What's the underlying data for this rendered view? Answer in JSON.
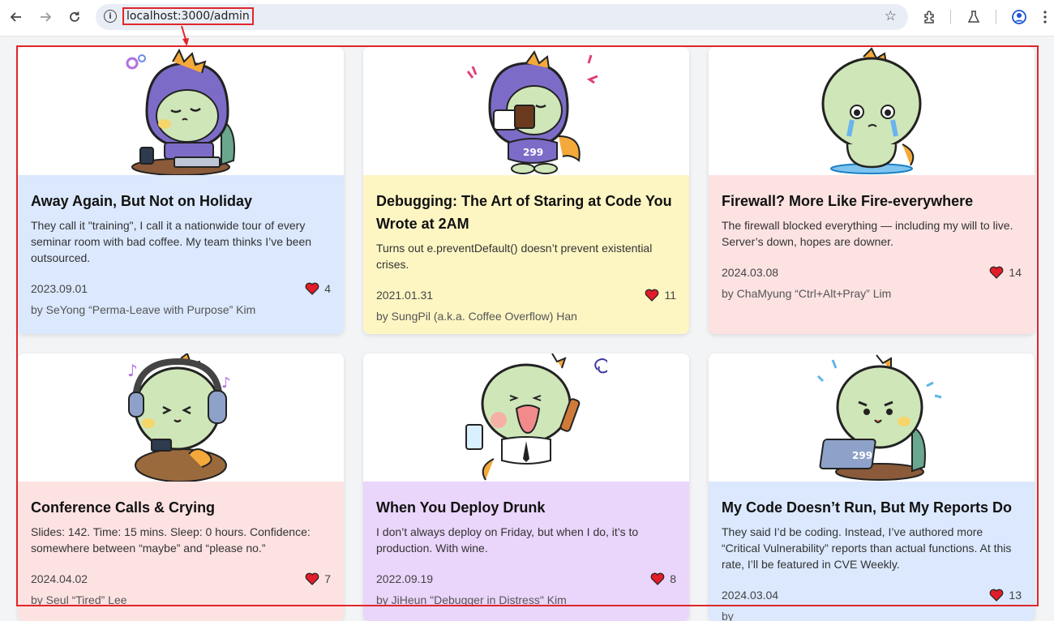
{
  "browser": {
    "url_host": "localhost",
    "url_path": ":3000/admin",
    "icons": [
      "back-arrow-icon",
      "forward-arrow-icon",
      "reload-icon",
      "site-info-icon",
      "bookmark-star-icon",
      "extensions-icon",
      "labs-flask-icon",
      "profile-icon",
      "menu-dots-icon"
    ]
  },
  "annotation": {
    "color": "#e0262b"
  },
  "cards": [
    {
      "title": "Away Again, But Not on Holiday",
      "text": "They call it \"training\", I call it a nationwide tour of every seminar room with bad coffee. My team thinks I’ve been outsourced.",
      "date": "2023.09.01",
      "likes": "4",
      "author": "by SeYong “Perma-Leave with Purpose” Kim",
      "color": "#dbe8fd",
      "art": "dino-hoodie-laptop"
    },
    {
      "title": "Debugging: The Art of Staring at Code You Wrote at 2AM",
      "text": "Turns out e.preventDefault() doesn’t prevent existential crises.",
      "date": "2021.01.31",
      "likes": "11",
      "author": "by SungPil (a.k.a. Coffee Overflow) Han",
      "color": "#fdf6c3",
      "art": "dino-hoodie-coffee"
    },
    {
      "title": "Firewall? More Like Fire-everywhere",
      "text": "The firewall blocked everything — including my will to live. Server’s down, hopes are downer.",
      "date": "2024.03.08",
      "likes": "14",
      "author": "by ChaMyung “Ctrl+Alt+Pray” Lim",
      "color": "#fde2e2",
      "art": "dino-crying"
    },
    {
      "title": "Conference Calls & Crying",
      "text": "Slides: 142. Time: 15 mins. Sleep: 0 hours. Confidence: somewhere between “maybe” and “please no.”",
      "date": "2024.04.02",
      "likes": "7",
      "author": "by Seul “Tired” Lee",
      "color": "#fde2e2",
      "art": "dino-headphones"
    },
    {
      "title": "When You Deploy Drunk",
      "text": "I don’t always deploy on Friday, but when I do, it’s to production. With wine.",
      "date": "2022.09.19",
      "likes": "8",
      "author": "by JiHeun \"Debugger in Distress\" Kim",
      "color": "#ead5fb",
      "art": "dino-drunk"
    },
    {
      "title": "My Code Doesn’t Run, But My Reports Do",
      "text": "They said I’d be coding. Instead, I’ve authored more “Critical Vulnerability” reports than actual functions. At this rate, I’ll be featured in CVE Weekly.",
      "date": "2024.03.04",
      "likes": "13",
      "author": "by",
      "color": "#dbe8fd",
      "art": "dino-laptop-sweat"
    }
  ]
}
